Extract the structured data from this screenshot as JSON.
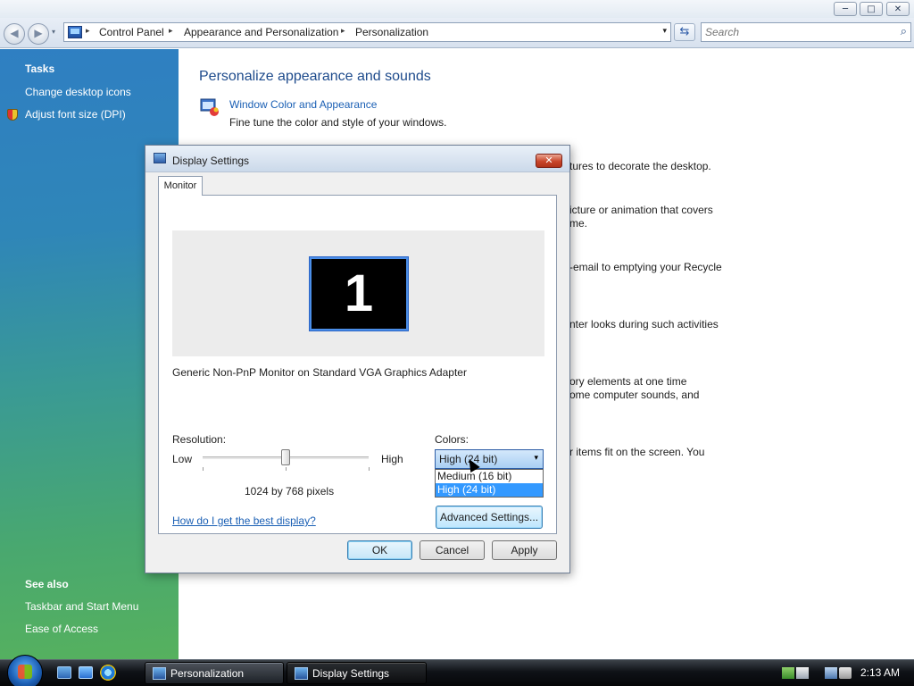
{
  "window": {
    "min_label": "─",
    "max_label": "□",
    "close_label": "✕"
  },
  "nav": {
    "back_label": "◀",
    "forward_label": "▶",
    "recent_label": "▾",
    "breadcrumbs": [
      "Control Panel",
      "Appearance and Personalization",
      "Personalization"
    ],
    "crumb_sep": "▸",
    "dropdown_label": "▾",
    "refresh_label": "⇆",
    "search_placeholder": "Search",
    "search_icon": "⌕"
  },
  "taskpane": {
    "tasks_heading": "Tasks",
    "tasks": [
      "Change desktop icons",
      "Adjust font size (DPI)"
    ],
    "see_also_heading": "See also",
    "see_also": [
      "Taskbar and Start Menu",
      "Ease of Access"
    ]
  },
  "main": {
    "title": "Personalize appearance and sounds",
    "items": [
      {
        "link": "Window Color and Appearance",
        "description": "Fine tune the color and style of your windows."
      }
    ],
    "partial_text": [
      "tures to decorate the desktop.",
      "icture or animation that covers",
      "me.",
      "-email to emptying your Recycle",
      "nter looks during such activities",
      "ory elements at one time",
      "ome computer sounds, and",
      "r items fit on the screen. You"
    ]
  },
  "dialog": {
    "title": "Display Settings",
    "close_label": "✕",
    "tab": "Monitor",
    "monitor_number": "1",
    "monitor_name": "Generic Non-PnP Monitor on Standard VGA Graphics Adapter",
    "resolution_label": "Resolution:",
    "low_label": "Low",
    "high_label": "High",
    "resolution_value": "1024 by 768 pixels",
    "colors_label": "Colors:",
    "colors_selected": "High (24 bit)",
    "colors_arrow": "▾",
    "colors_options": [
      "Medium (16 bit)",
      "High (24 bit)"
    ],
    "help_link": "How do I get the best display?",
    "advanced_button": "Advanced Settings...",
    "ok_button": "OK",
    "cancel_button": "Cancel",
    "apply_button": "Apply"
  },
  "taskbar": {
    "buttons": [
      "Personalization",
      "Display Settings"
    ],
    "clock": "2:13 AM"
  }
}
